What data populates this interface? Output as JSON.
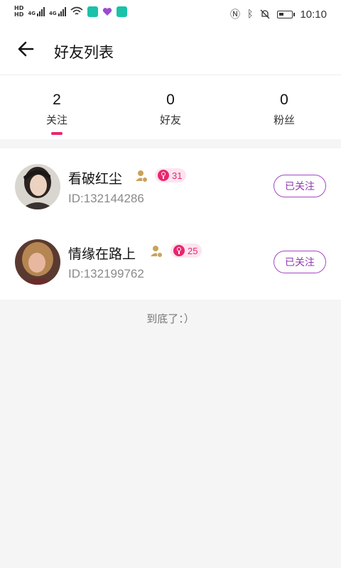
{
  "status_bar": {
    "left_labels": [
      "HD",
      "HD",
      "4G",
      "4G"
    ],
    "time": "10:10"
  },
  "header": {
    "back_icon": "arrow-left-icon",
    "title": "好友列表"
  },
  "stats": [
    {
      "count": "2",
      "label": "关注",
      "active": true
    },
    {
      "count": "0",
      "label": "好友",
      "active": false
    },
    {
      "count": "0",
      "label": "粉丝",
      "active": false
    }
  ],
  "friends": [
    {
      "name": "看破红尘",
      "level": "31",
      "id_text": "ID:132144286",
      "button": "已关注"
    },
    {
      "name": "情缘在路上",
      "level": "25",
      "id_text": "ID:132199762",
      "button": "已关注"
    }
  ],
  "footer": "到底了：）",
  "colors": {
    "accent": "#e8266d",
    "follow_border": "#a447c4",
    "badge_bg": "#fde4ef",
    "page_bg": "#f5f5f5"
  }
}
